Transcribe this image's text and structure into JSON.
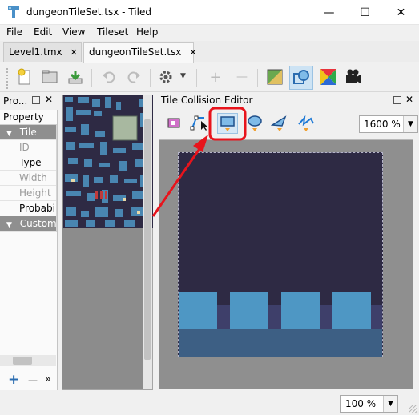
{
  "window": {
    "title": "dungeonTileSet.tsx - Tiled",
    "minimize": "—",
    "maximize": "☐",
    "close": "✕"
  },
  "menu": [
    "File",
    "Edit",
    "View",
    "Tileset",
    "Help"
  ],
  "tabs": [
    {
      "label": "Level1.tmx",
      "close": "✕"
    },
    {
      "label": "dungeonTileSet.tsx",
      "close": "✕"
    }
  ],
  "toolbar": {
    "icons": [
      "new-icon",
      "open-icon",
      "save-icon",
      "undo-icon",
      "redo-icon",
      "gear-icon",
      "add-icon",
      "remove-icon",
      "terrain-icon",
      "collision-icon",
      "wang-icon",
      "camera-icon"
    ],
    "gear_dropdown": "▼",
    "add": "+",
    "remove": "—"
  },
  "properties_panel": {
    "title": "Pro...",
    "header": "Property",
    "rows": [
      {
        "label": "Tile",
        "type": "group",
        "arrow": "▼"
      },
      {
        "label": "ID",
        "type": "disabled"
      },
      {
        "label": "Type",
        "type": "normal"
      },
      {
        "label": "Width",
        "type": "disabled"
      },
      {
        "label": "Height",
        "type": "disabled"
      },
      {
        "label": "Probabil",
        "type": "normal"
      },
      {
        "label": "Custom",
        "type": "group",
        "arrow": "▼"
      }
    ],
    "footer": {
      "add": "+",
      "remove": "—",
      "more": "»"
    }
  },
  "collision_editor": {
    "title": "Tile Collision Editor",
    "zoom": "1600 %",
    "tools": [
      "select-objects-icon",
      "edit-polygon-icon",
      "rectangle-icon",
      "ellipse-icon",
      "polygon-icon",
      "polyline-icon"
    ]
  },
  "status": {
    "zoom": "100 %"
  },
  "colors": {
    "tile_background": "#2e2a44",
    "water_light": "#4e97c4",
    "water_dark": "#3d5f84",
    "highlight": "#e8141c"
  }
}
